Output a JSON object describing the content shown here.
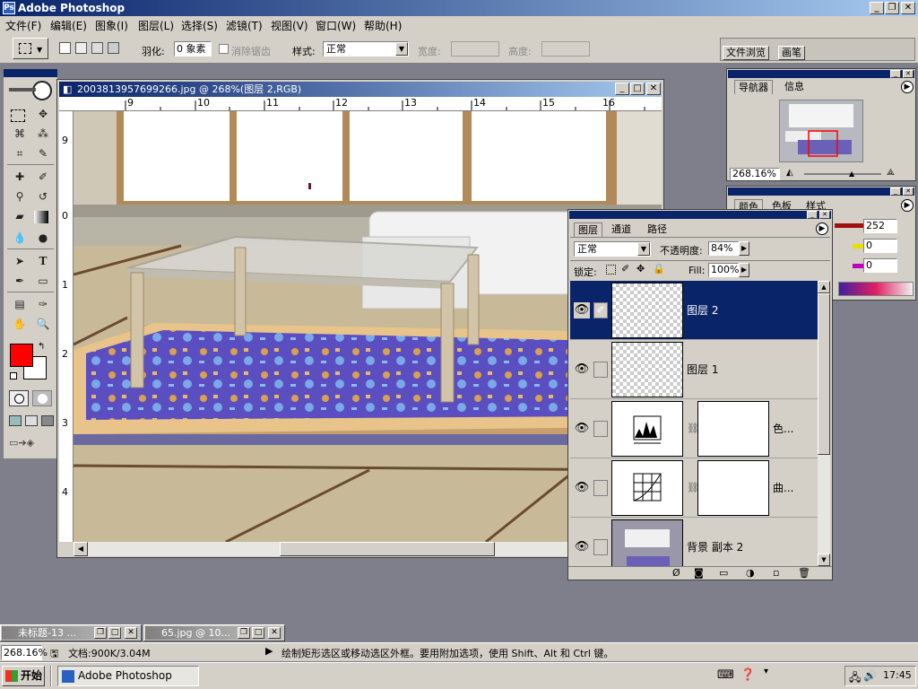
{
  "app": {
    "title": "Adobe Photoshop"
  },
  "menu": [
    "文件(F)",
    "编辑(E)",
    "图象(I)",
    "图层(L)",
    "选择(S)",
    "滤镜(T)",
    "视图(V)",
    "窗口(W)",
    "帮助(H)"
  ],
  "options": {
    "feather_label": "羽化:",
    "feather_value": "0 象素",
    "antialias_label": "消除锯齿",
    "style_label": "样式:",
    "style_value": "正常",
    "width_label": "宽度:",
    "height_label": "高度:",
    "palette_tabs": [
      "文件浏览",
      "画笔"
    ]
  },
  "document": {
    "title": "2003813957699266.jpg @ 268%(图层 2,RGB)",
    "ruler_top": [
      "9",
      "10",
      "11",
      "12",
      "13",
      "14",
      "15",
      "16"
    ],
    "ruler_left": [
      "9",
      "0",
      "1",
      "2",
      "3",
      "4"
    ]
  },
  "navigator": {
    "tabs": [
      "导航器",
      "信息"
    ],
    "zoom": "268.16%"
  },
  "color_panel": {
    "tabs": [
      "颜色",
      "色板",
      "样式"
    ],
    "values": [
      "252",
      "0",
      "0"
    ]
  },
  "layers": {
    "tabs": [
      "图层",
      "通道",
      "路径"
    ],
    "blend_mode": "正常",
    "opacity_label": "不透明度:",
    "opacity_value": "84%",
    "lock_label": "锁定:",
    "fill_label": "Fill:",
    "fill_value": "100%",
    "items": [
      {
        "name": "图层 2",
        "selected": true
      },
      {
        "name": "图层 1",
        "selected": false
      },
      {
        "name": "色...",
        "selected": false
      },
      {
        "name": "曲...",
        "selected": false
      },
      {
        "name": "背景 副本 2",
        "selected": false
      }
    ]
  },
  "minimized": [
    {
      "title": "未标题-13 ..."
    },
    {
      "title": "65.jpg @ 10..."
    }
  ],
  "status": {
    "zoom": "268.16%",
    "doc_size": "文档:900K/3.04M",
    "hint": "绘制矩形选区或移动选区外框。要用附加选项，使用 Shift、Alt 和 Ctrl 键。"
  },
  "taskbar": {
    "start_label": "开始",
    "task_label": "Adobe Photoshop",
    "clock": "17:45"
  },
  "colors": {
    "foreground": "#ff0000",
    "background": "#ffffff",
    "title_active": "#0a246a"
  }
}
